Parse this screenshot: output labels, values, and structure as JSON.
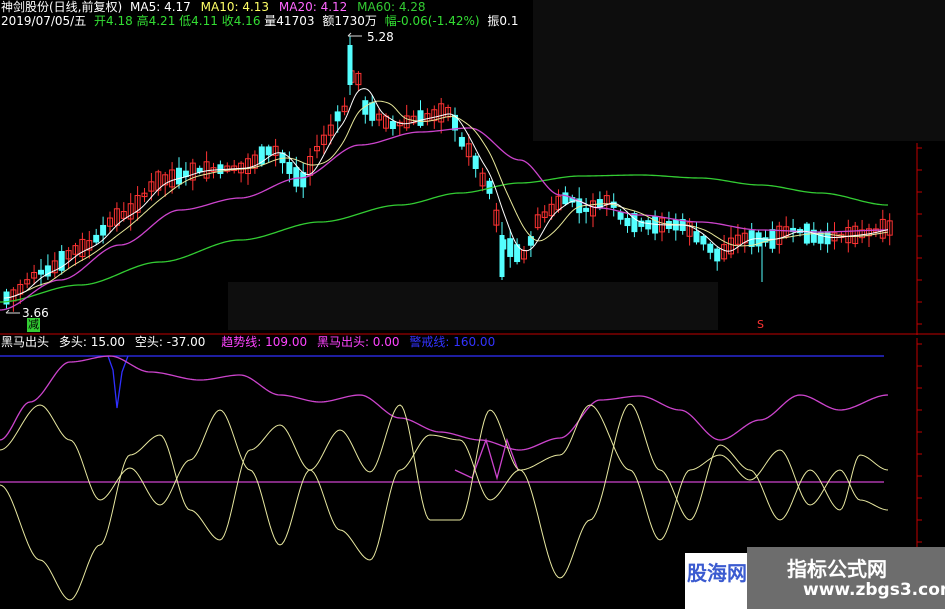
{
  "header": {
    "stock": "神剑股份(日线,前复权)",
    "ma5": "MA5: 4.17",
    "ma10": "MA10: 4.13",
    "ma20": "MA20: 4.12",
    "ma60": "MA60: 4.28",
    "date": "2019/07/05/五",
    "open": "开4.18",
    "high": "高4.21",
    "low": "低4.11",
    "close": "收4.16",
    "volume": "量41703",
    "amount": "额1730万",
    "change": "幅-0.06(-1.42%)",
    "amplitude": "振0.1"
  },
  "price_chart": {
    "high_label": "5.28",
    "low_label": "3.66",
    "signal_label": "减",
    "marker_label": "S"
  },
  "indicator": {
    "name": "黑马出头",
    "bull": "多头: 15.00",
    "bear": "空头: -37.00",
    "trend": "趋势线: 109.00",
    "horse": "黑马出头: 0.00",
    "warn": "警戒线: 160.00"
  },
  "watermarks": {
    "left": "股海网",
    "right_title": "指标公式网",
    "right_url": "www.zbgs3.com"
  },
  "colors": {
    "up": "#ff3333",
    "down": "#54ffff",
    "ma5": "#ffffff",
    "ma10": "#ffff66",
    "ma20": "#ff66ff",
    "ma60": "#33cc33",
    "axis": "#c00000",
    "indicator_yellow": "#ffff99",
    "indicator_purple": "#cc44cc",
    "warn_line": "#3030ff"
  }
}
